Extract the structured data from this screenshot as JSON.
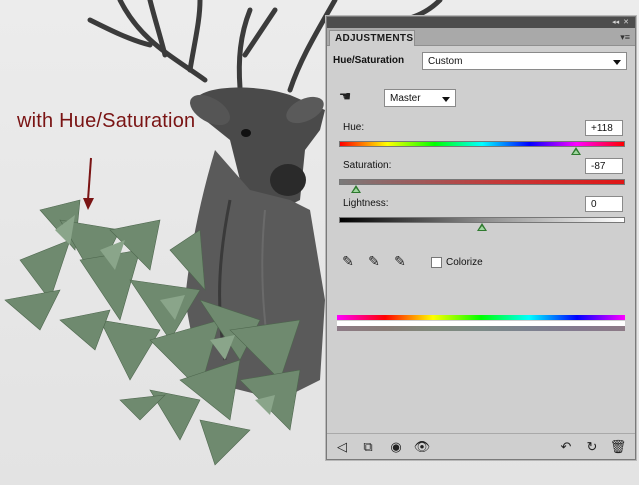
{
  "annotation": {
    "text": "with Hue/Saturation",
    "color": "#7a1414"
  },
  "panel": {
    "tab_label": "ADJUSTMENTS",
    "preset_label": "Hue/Saturation",
    "preset_value": "Custom",
    "channel_value": "Master",
    "hue": {
      "label": "Hue:",
      "value": "+118",
      "percent": 83
    },
    "saturation": {
      "label": "Saturation:",
      "value": "-87",
      "percent": 6
    },
    "lightness": {
      "label": "Lightness:",
      "value": "0",
      "percent": 50
    },
    "colorize_label": "Colorize",
    "colorize_checked": false
  },
  "icons": {
    "targeted_adjustment": "hand-scrub-icon",
    "eyedropper": "eyedropper-icon",
    "eyedropper_add": "eyedropper-plus-icon",
    "eyedropper_subtract": "eyedropper-minus-icon",
    "back": "back-arrow-icon",
    "clip": "clip-to-layer-icon",
    "visibility": "eye-icon",
    "previous_state": "previous-state-icon",
    "reset": "reset-icon",
    "delete": "trash-icon"
  },
  "colors": {
    "panel_bg": "#cfcfcf",
    "topbar": "#4d4d4d",
    "slider_thumb": "#2f7a2f",
    "shards": "#6f8a6f"
  }
}
